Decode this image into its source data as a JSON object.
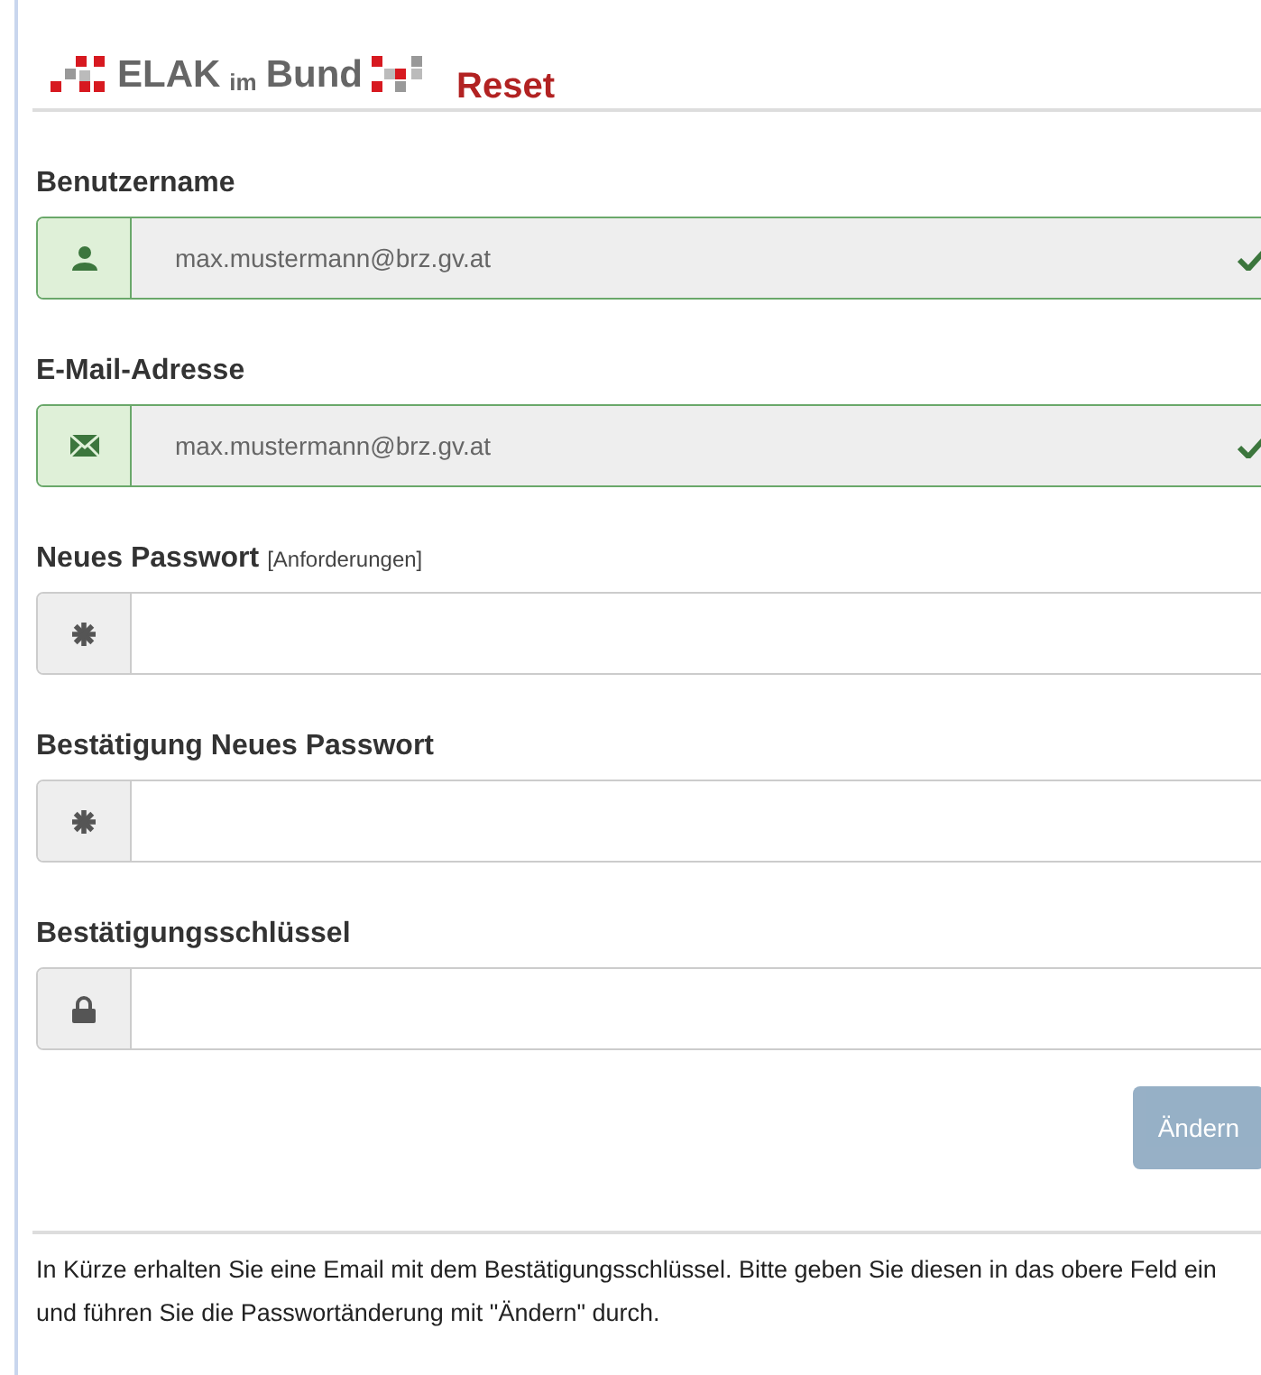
{
  "header": {
    "logo_words": [
      "ELAK",
      "im",
      "Bund"
    ],
    "title": "Reset"
  },
  "fields": [
    {
      "label": "Benutzername",
      "kind": "user",
      "value": "max.mustermann@brz.gv.at",
      "readonly": true,
      "valid": true
    },
    {
      "label": "E-Mail-Adresse",
      "kind": "email",
      "value": "max.mustermann@brz.gv.at",
      "readonly": true,
      "valid": true
    },
    {
      "label": "Neues Passwort",
      "link": "[Anforderungen]",
      "kind": "password",
      "readonly": false,
      "valid": false
    },
    {
      "label": "Bestätigung Neues Passwort",
      "kind": "password",
      "readonly": false,
      "valid": false
    },
    {
      "label": "Bestätigungsschlüssel",
      "kind": "key",
      "readonly": false,
      "valid": false
    }
  ],
  "submit": {
    "label": "Ändern",
    "disabled": true
  },
  "info": "In Kürze erhalten Sie eine Email mit dem Bestätigungsschlüssel. Bitte geben Sie diesen in das obere Feld ein und führen Sie die Passwortänderung mit \"Ändern\" durch."
}
